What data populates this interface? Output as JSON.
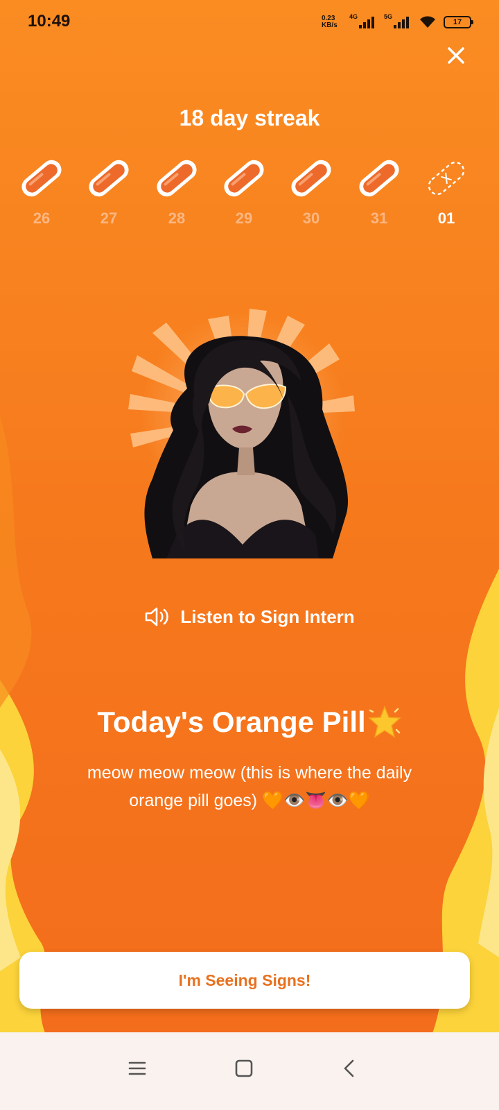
{
  "status_bar": {
    "time": "10:49",
    "net_speed": "0.23\nKB/s",
    "signal_1_label": "4G",
    "signal_2_label": "5G",
    "battery": "17"
  },
  "streak": {
    "title": "18 day streak",
    "days": [
      {
        "label": "26",
        "completed": true
      },
      {
        "label": "27",
        "completed": true
      },
      {
        "label": "28",
        "completed": true
      },
      {
        "label": "29",
        "completed": true
      },
      {
        "label": "30",
        "completed": true
      },
      {
        "label": "31",
        "completed": true
      },
      {
        "label": "01",
        "completed": false,
        "current": true
      }
    ]
  },
  "listen": {
    "label": "Listen to Sign Intern"
  },
  "pill": {
    "heading": "Today's Orange Pill",
    "heading_emoji": "star-icon",
    "text": "meow meow meow (this is where the daily orange pill goes) 🧡👁️👅👁️🧡"
  },
  "cta": {
    "label": "I'm Seeing Signs!"
  },
  "colors": {
    "background": "#f6781c",
    "flame": "#fcd33a",
    "pill_fill": "#ed6a2a",
    "cta_text": "#e8711e"
  }
}
